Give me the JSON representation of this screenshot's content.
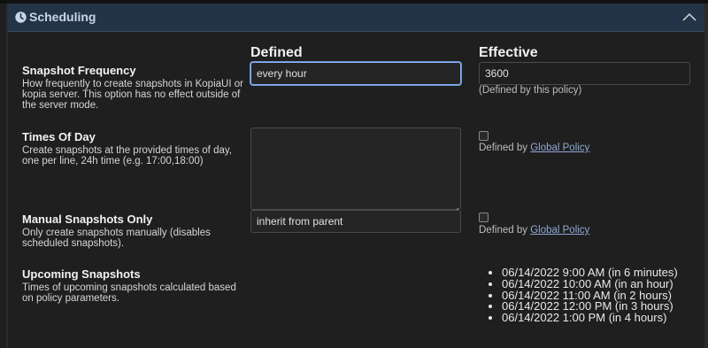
{
  "section": {
    "title": "Scheduling",
    "icon": "clock-icon",
    "collapse_icon": "chevron-up-icon"
  },
  "columns": {
    "defined": "Defined",
    "effective": "Effective"
  },
  "rows": {
    "snapshot_frequency": {
      "title": "Snapshot Frequency",
      "desc": "How frequently to create snapshots in KopiaUI or kopia server. This option has no effect outside of the server mode.",
      "defined_value": "every hour",
      "effective_value": "3600",
      "effective_note": "(Defined by this policy)"
    },
    "times_of_day": {
      "title": "Times Of Day",
      "desc": "Create snapshots at the provided times of day, one per line, 24h time (e.g. 17:00,18:00)",
      "defined_value": "",
      "defined_by_prefix": "Defined by ",
      "defined_by_link": "Global Policy"
    },
    "manual_only": {
      "title": "Manual Snapshots Only",
      "desc": "Only create snapshots manually (disables scheduled snapshots).",
      "defined_value": "inherit from parent",
      "defined_by_prefix": "Defined by ",
      "defined_by_link": "Global Policy"
    },
    "upcoming": {
      "title": "Upcoming Snapshots",
      "desc": "Times of upcoming snapshots calculated based on policy parameters.",
      "items": [
        "06/14/2022 9:00 AM (in 6 minutes)",
        "06/14/2022 10:00 AM (in an hour)",
        "06/14/2022 11:00 AM (in 2 hours)",
        "06/14/2022 12:00 PM (in 3 hours)",
        "06/14/2022 1:00 PM (in 4 hours)"
      ]
    }
  },
  "colors": {
    "header_bg": "#243448",
    "header_text": "#c7d6e8",
    "link": "#8fa7d6",
    "focus": "#8ab4f8"
  }
}
